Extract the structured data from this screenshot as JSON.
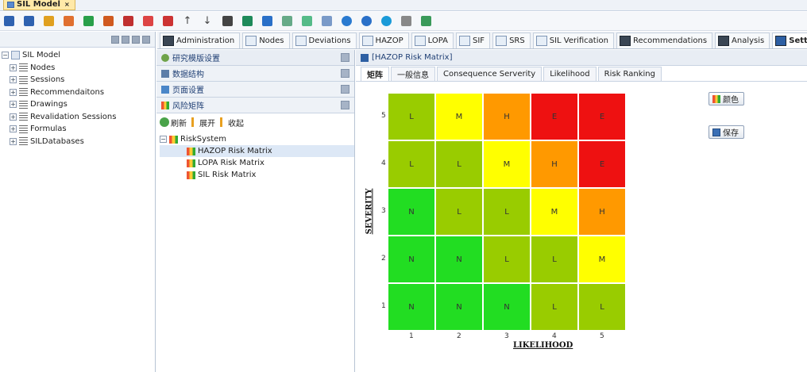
{
  "window": {
    "tab_label": "SIL Model",
    "close_glyph": "×"
  },
  "toolbar_icons": [
    "save-icon",
    "save-as-icon",
    "folder-icon",
    "edit-icon",
    "add-icon",
    "tools-icon",
    "cut-icon",
    "copy-icon",
    "paste-icon",
    "arrow-up-icon",
    "arrow-down-icon",
    "import-icon",
    "stack-icon",
    "report-icon",
    "grid-icon",
    "sparkle-icon",
    "wand-icon",
    "globe-icon",
    "refresh-icon",
    "help-icon",
    "dropdown-icon",
    "table-icon"
  ],
  "left_tree": {
    "root": "SIL Model",
    "items": [
      "Nodes",
      "Sessions",
      "Recommendaitons",
      "Drawings",
      "Revalidation Sessions",
      "Formulas",
      "SILDatabases"
    ]
  },
  "module_tabs": [
    "Administration",
    "Nodes",
    "Deviations",
    "HAZOP",
    "LOPA",
    "SIF",
    "SRS",
    "SIL Verification",
    "Recommendations",
    "Analysis",
    "Settings"
  ],
  "middle": {
    "title": "研究模版设置",
    "sections": [
      "数据结构",
      "页面设置",
      "风险矩阵"
    ],
    "actions": [
      "刷新",
      "展开",
      "收起"
    ],
    "tree_root": "RiskSystem",
    "tree_items": [
      "HAZOP Risk Matrix",
      "LOPA Risk Matrix",
      "SIL Risk Matrix"
    ]
  },
  "right": {
    "title": "[HAZOP Risk Matrix]",
    "subtabs": [
      "矩阵",
      "一般信息",
      "Consequence Serverity",
      "Likelihood",
      "Risk Ranking"
    ],
    "buttons": {
      "color": "颜色",
      "save": "保存"
    }
  },
  "chart_data": {
    "type": "heatmap",
    "xlabel": "LIKELIHOOD",
    "ylabel": "SEVERITY",
    "x": [
      1,
      2,
      3,
      4,
      5
    ],
    "y": [
      1,
      2,
      3,
      4,
      5
    ],
    "matrix_top_to_bottom": [
      [
        "L",
        "M",
        "H",
        "E",
        "E"
      ],
      [
        "L",
        "L",
        "M",
        "H",
        "E"
      ],
      [
        "N",
        "L",
        "L",
        "M",
        "H"
      ],
      [
        "N",
        "N",
        "L",
        "L",
        "M"
      ],
      [
        "N",
        "N",
        "N",
        "L",
        "L"
      ]
    ],
    "colors": {
      "N": "#22dd22",
      "L": "#99cc00",
      "M": "#ffff00",
      "H": "#ff9900",
      "E": "#ee1111"
    }
  }
}
